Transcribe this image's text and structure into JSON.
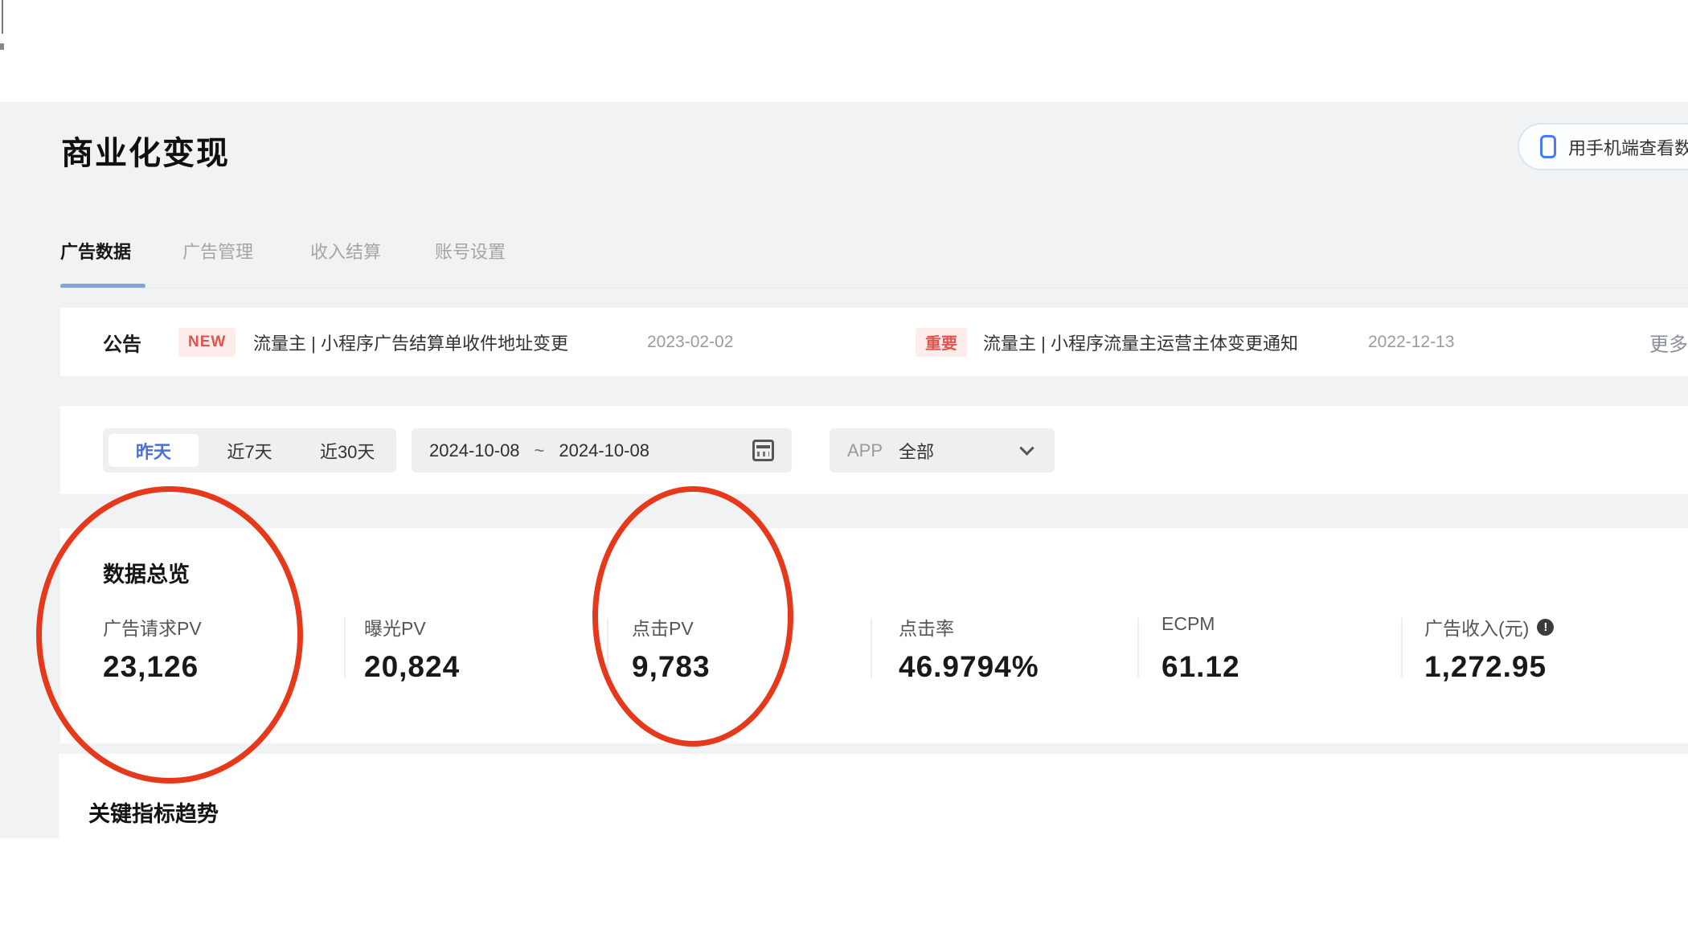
{
  "page": {
    "title": "商业化变现"
  },
  "header": {
    "mobile_button": {
      "label": "用手机端查看数据",
      "icon": "phone-icon"
    }
  },
  "tabs": [
    {
      "label": "广告数据",
      "active": true
    },
    {
      "label": "广告管理",
      "active": false
    },
    {
      "label": "收入结算",
      "active": false
    },
    {
      "label": "账号设置",
      "active": false
    }
  ],
  "announcement": {
    "title": "公告",
    "items": [
      {
        "badge": "NEW",
        "text": "流量主 | 小程序广告结算单收件地址变更",
        "date": "2023-02-02"
      },
      {
        "badge": "重要",
        "text": "流量主 | 小程序流量主运营主体变更通知",
        "date": "2022-12-13"
      }
    ],
    "more_label": "更多"
  },
  "filters": {
    "quick_ranges": [
      {
        "label": "昨天",
        "selected": true
      },
      {
        "label": "近7天",
        "selected": false
      },
      {
        "label": "近30天",
        "selected": false
      }
    ],
    "date_range": {
      "start": "2024-10-08",
      "separator": "~",
      "end": "2024-10-08",
      "icon": "calendar-icon"
    },
    "app_select": {
      "label": "APP",
      "value": "全部",
      "icon": "chevron-down-icon"
    }
  },
  "overview": {
    "heading": "数据总览",
    "metrics": [
      {
        "label": "广告请求PV",
        "value": "23,126",
        "circled": true
      },
      {
        "label": "曝光PV",
        "value": "20,824",
        "circled": false
      },
      {
        "label": "点击PV",
        "value": "9,783",
        "circled": true
      },
      {
        "label": "点击率",
        "value": "46.9794%",
        "circled": false
      },
      {
        "label": "ECPM",
        "value": "61.12",
        "circled": false
      },
      {
        "label": "广告收入(元)",
        "value": "1,272.95",
        "info_icon": "exclamation-info-icon",
        "circled": false
      }
    ]
  },
  "trend": {
    "heading": "关键指标趋势"
  },
  "annotations": {
    "color": "#e6391b",
    "ellipses": [
      {
        "target": "广告请求PV 23,126"
      },
      {
        "target": "点击PV 9,783"
      }
    ]
  },
  "colors": {
    "accent_blue": "#4b6fd8",
    "underline_blue": "#7ba7df",
    "badge_red": "#e0544c",
    "badge_bg": "#fdecec",
    "page_bg": "#f1f2f3",
    "annotation_red": "#e6391b"
  }
}
